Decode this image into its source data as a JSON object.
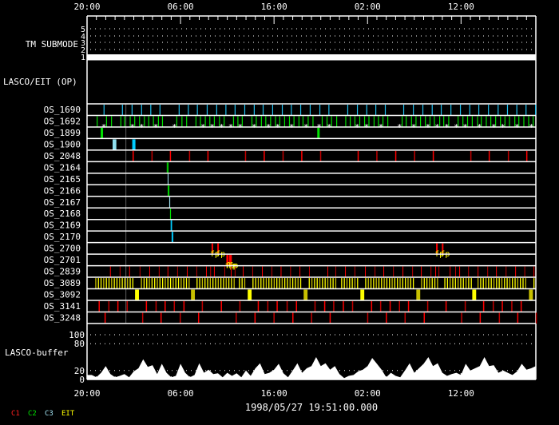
{
  "chart_data": {
    "type": "timeline",
    "start_label": "1998/05/27 19:51:00.000",
    "time_ticks": [
      "20:00",
      "06:00",
      "16:00",
      "02:00",
      "12:00"
    ],
    "time_range": [
      "20:00",
      "20:00"
    ],
    "background": "#000000",
    "foreground": "#ffffff",
    "shading": {
      "from": "00:06",
      "to": "00:12",
      "color": "#505050"
    },
    "tm_submode": {
      "label": "TM SUBMODE",
      "levels": [
        "1",
        "2",
        "3",
        "4",
        "5"
      ],
      "value": 1
    },
    "op_panel": {
      "label": "LASCO/EIT (OP)"
    },
    "rows": [
      {
        "name": "OS_1690",
        "color": "#20c0f0",
        "width": 1.2,
        "events": [
          "21:49",
          "23:47",
          "00:49",
          "01:50",
          "02:49",
          "03:48",
          "05:51",
          "06:50",
          "07:48",
          "08:51",
          "09:52",
          "10:51",
          "11:50",
          "12:52",
          "13:53",
          "14:50",
          "15:51",
          "16:53",
          "17:51",
          "18:51",
          "19:52",
          "20:54",
          "21:52",
          "23:53",
          "00:55",
          "01:55",
          "02:53",
          "03:54",
          "05:52",
          "06:54",
          "07:55",
          "08:55",
          "09:53",
          "10:55",
          "11:56",
          "12:56",
          "13:54",
          "14:56",
          "15:58",
          "16:58",
          "17:58",
          "18:57",
          "19:58"
        ]
      },
      {
        "name": "OS_1692",
        "color": "#00e000",
        "width": 1.2,
        "events": [
          "21:05",
          "22:05",
          "22:37",
          "23:37",
          "00:01",
          "00:37",
          "01:06",
          "01:37",
          "02:08",
          "02:36",
          "03:06",
          "03:38",
          "04:04",
          "05:36",
          "06:09",
          "06:39",
          "07:39",
          "08:08",
          "08:39",
          "09:08",
          "09:37",
          "10:10",
          "10:40",
          "11:40",
          "12:08",
          "12:36",
          "13:38",
          "14:06",
          "14:39",
          "15:07",
          "15:38",
          "16:09",
          "16:37",
          "17:08",
          "17:39",
          "18:08",
          "18:40",
          "19:06",
          "19:39",
          "20:10",
          "21:09",
          "21:40",
          "22:09",
          "22:42",
          "23:40",
          "00:09",
          "00:39",
          "01:10",
          "01:41",
          "02:09",
          "02:42",
          "03:10",
          "03:39",
          "04:10",
          "05:42",
          "06:08",
          "06:42",
          "07:11",
          "07:40",
          "08:11",
          "08:41",
          "09:09",
          "09:43",
          "10:09",
          "10:41",
          "11:41",
          "12:12",
          "12:42",
          "13:12",
          "13:46",
          "14:10",
          "14:42",
          "15:11",
          "15:42",
          "16:13",
          "16:42",
          "17:11",
          "17:45",
          "18:11",
          "18:43",
          "19:14",
          "19:43"
        ],
        "markers": {
          "symbol": "*",
          "color": "#ffffff",
          "events": [
            "21:48",
            "00:51",
            "01:50",
            "03:21",
            "05:20",
            "08:24",
            "09:23",
            "10:23",
            "11:23",
            "12:23",
            "13:52",
            "15:24",
            "16:24",
            "17:53",
            "19:25",
            "20:49",
            "21:54",
            "00:53",
            "01:53",
            "03:26",
            "05:25",
            "06:56",
            "08:28",
            "09:26",
            "10:28",
            "11:29",
            "12:27",
            "13:58",
            "15:30",
            "16:28",
            "17:59",
            "19:31"
          ]
        }
      },
      {
        "name": "OS_1899",
        "color": "#00e000",
        "width": 3,
        "events": [
          "21:35",
          "20:45"
        ]
      },
      {
        "name": "OS_1900",
        "colors": [
          "#90e0f0",
          "#00ccff"
        ],
        "blocks": [
          [
            "22:44",
            "23:08"
          ],
          [
            "00:50",
            "01:09"
          ]
        ]
      },
      {
        "name": "OS_2048",
        "colors": [
          "#ff0000",
          "#c00000"
        ],
        "width": 1.5,
        "events": [
          "00:56",
          "02:57",
          "04:55",
          "06:58",
          "08:56",
          "12:57",
          "14:57",
          "16:58",
          "18:58",
          "20:59",
          "01:00",
          "03:00",
          "05:01",
          "07:02",
          "09:02",
          "13:03",
          "15:01",
          "17:04",
          "19:02"
        ]
      },
      {
        "name": "OS_2164",
        "color": "#00e000",
        "width": 1,
        "events": [
          "04:34",
          "04:40"
        ]
      },
      {
        "name": "OS_2165",
        "color": "#a0e0f0",
        "width": 1,
        "events": [
          "04:40",
          "04:40"
        ]
      },
      {
        "name": "OS_2166",
        "color": "#00e000",
        "width": 1,
        "events": [
          "04:40",
          "04:46"
        ]
      },
      {
        "name": "OS_2167",
        "color": "#a0e0f0",
        "width": 1,
        "events": [
          "04:50",
          "04:51"
        ]
      },
      {
        "name": "OS_2168",
        "color": "#00e000",
        "width": 1,
        "events": [
          "04:55",
          "04:56"
        ]
      },
      {
        "name": "OS_2169",
        "color": "#00ccff",
        "width": 1,
        "events": [
          "04:59",
          "05:03"
        ]
      },
      {
        "name": "OS_2170",
        "color": "#00ccff",
        "width": 1,
        "events": [
          "05:05",
          "05:11"
        ]
      },
      {
        "name": "OS_2700",
        "color": "#ff0000",
        "width": 2,
        "events": [
          "09:24",
          "10:01",
          "09:25",
          "10:02"
        ],
        "label": {
          "text": "fp",
          "color": "#ffff00"
        }
      },
      {
        "name": "OS_2701",
        "color": "#ff0000",
        "width": 2,
        "events": [
          "10:59",
          "11:16",
          "11:02",
          "11:24"
        ],
        "label": {
          "text": "fp",
          "color": "#ffff00"
        }
      },
      {
        "name": "OS_2839",
        "colors": [
          "#ff0000",
          "#c00000"
        ],
        "width": 1,
        "events": [
          "22:30",
          "23:32",
          "00:33",
          "01:40",
          "02:42",
          "03:43",
          "04:39",
          "05:41",
          "06:43",
          "07:44",
          "08:46",
          "09:13",
          "09:37",
          "10:44",
          "11:25",
          "11:50",
          "12:42",
          "13:43",
          "14:45",
          "15:46",
          "16:45",
          "17:46",
          "18:46",
          "19:47",
          "21:45",
          "22:36",
          "23:38",
          "00:39",
          "01:46",
          "02:48",
          "03:44",
          "04:46",
          "05:47",
          "06:49",
          "07:45",
          "08:47",
          "09:17",
          "09:38",
          "10:50",
          "11:25",
          "11:51",
          "12:48",
          "13:49",
          "14:51",
          "15:47",
          "16:49",
          "17:50",
          "18:49",
          "19:48"
        ]
      },
      {
        "name": "OS_3089",
        "colors": [
          "#ffff00",
          "#c8c000"
        ],
        "width": 1.3,
        "ranges": [
          [
            "20:56",
            "01:01"
          ],
          [
            "01:49",
            "07:05"
          ],
          [
            "07:46",
            "11:50"
          ],
          [
            "12:18",
            "13:00"
          ],
          [
            "13:45",
            "19:06"
          ],
          [
            "19:46",
            "22:49"
          ],
          [
            "23:14",
            "01:07"
          ],
          [
            "01:48",
            "07:04"
          ],
          [
            "07:47",
            "09:30"
          ],
          [
            "10:16",
            "13:08"
          ],
          [
            "13:49",
            "19:07"
          ],
          [
            "19:48",
            "19:48"
          ]
        ],
        "range_step_min": 17
      },
      {
        "name": "OS_3092",
        "colors": [
          "#ffff00",
          "#c8c000"
        ],
        "blocks": [
          [
            "01:08",
            "01:33"
          ],
          [
            "07:07",
            "07:32"
          ],
          [
            "13:11",
            "13:36"
          ],
          [
            "19:10",
            "19:35"
          ],
          [
            "01:14",
            "01:39"
          ],
          [
            "07:13",
            "07:38"
          ],
          [
            "13:12",
            "13:37"
          ],
          [
            "19:16",
            "19:41"
          ]
        ]
      },
      {
        "name": "OS_3141",
        "colors": [
          "#ff0000",
          "#c00000"
        ],
        "width": 1.5,
        "events": [
          "21:18",
          "22:20",
          "23:18",
          "00:18",
          "02:21",
          "03:23",
          "04:21",
          "05:20",
          "06:22",
          "08:20",
          "10:22",
          "12:21",
          "14:19",
          "15:20",
          "16:20",
          "17:24",
          "18:24",
          "20:23",
          "21:25",
          "22:23",
          "23:25",
          "00:24",
          "02:26",
          "03:24",
          "04:25",
          "05:25",
          "06:23",
          "08:26",
          "10:24",
          "12:27",
          "14:25",
          "15:27",
          "16:25",
          "17:26",
          "18:26"
        ]
      },
      {
        "name": "OS_3248",
        "colors": [
          "#ff0000",
          "#c00000"
        ],
        "width": 1.5,
        "events": [
          "21:56",
          "01:57",
          "03:55",
          "05:58",
          "07:56",
          "11:57",
          "13:58",
          "16:00",
          "18:01",
          "20:01",
          "22:00",
          "02:01",
          "04:01",
          "06:01",
          "08:04",
          "12:04",
          "14:03",
          "16:06",
          "18:04",
          "20:03"
        ]
      }
    ],
    "buffer": {
      "label": "LASCO-buffer",
      "ylim": [
        0,
        100
      ],
      "yticks": [
        "0",
        "20",
        "80",
        "100"
      ],
      "gridlines": [
        20,
        80,
        100
      ],
      "points": [
        [
          "20:00",
          10
        ],
        [
          "20:30",
          10
        ],
        [
          "21:00",
          5
        ],
        [
          "21:30",
          15
        ],
        [
          "22:00",
          30
        ],
        [
          "22:30",
          12
        ],
        [
          "23:00",
          5
        ],
        [
          "23:30",
          8
        ],
        [
          "00:00",
          12
        ],
        [
          "00:30",
          5
        ],
        [
          "01:00",
          18
        ],
        [
          "01:30",
          25
        ],
        [
          "02:00",
          45
        ],
        [
          "02:30",
          28
        ],
        [
          "03:00",
          32
        ],
        [
          "03:30",
          12
        ],
        [
          "04:00",
          35
        ],
        [
          "04:30",
          15
        ],
        [
          "05:00",
          5
        ],
        [
          "05:30",
          8
        ],
        [
          "06:00",
          35
        ],
        [
          "06:30",
          15
        ],
        [
          "07:00",
          5
        ],
        [
          "07:30",
          10
        ],
        [
          "08:00",
          36
        ],
        [
          "08:30",
          15
        ],
        [
          "09:00",
          22
        ],
        [
          "09:30",
          12
        ],
        [
          "10:00",
          14
        ],
        [
          "10:30",
          5
        ],
        [
          "11:00",
          15
        ],
        [
          "11:30",
          8
        ],
        [
          "12:00",
          14
        ],
        [
          "12:30",
          5
        ],
        [
          "13:00",
          20
        ],
        [
          "13:30",
          8
        ],
        [
          "14:00",
          25
        ],
        [
          "14:30",
          36
        ],
        [
          "15:00",
          12
        ],
        [
          "15:30",
          15
        ],
        [
          "16:00",
          22
        ],
        [
          "16:30",
          35
        ],
        [
          "17:00",
          14
        ],
        [
          "17:30",
          5
        ],
        [
          "18:00",
          20
        ],
        [
          "18:30",
          36
        ],
        [
          "19:00",
          15
        ],
        [
          "19:30",
          25
        ],
        [
          "20:00",
          30
        ],
        [
          "20:30",
          50
        ],
        [
          "21:00",
          30
        ],
        [
          "21:30",
          36
        ],
        [
          "22:00",
          22
        ],
        [
          "22:30",
          30
        ],
        [
          "23:00",
          12
        ],
        [
          "23:30",
          3
        ],
        [
          "00:00",
          8
        ],
        [
          "00:30",
          10
        ],
        [
          "01:00",
          18
        ],
        [
          "01:30",
          22
        ],
        [
          "02:00",
          30
        ],
        [
          "02:30",
          48
        ],
        [
          "03:00",
          35
        ],
        [
          "03:30",
          22
        ],
        [
          "04:00",
          5
        ],
        [
          "04:30",
          15
        ],
        [
          "05:00",
          8
        ],
        [
          "05:30",
          5
        ],
        [
          "06:00",
          20
        ],
        [
          "06:30",
          36
        ],
        [
          "07:00",
          15
        ],
        [
          "07:30",
          25
        ],
        [
          "08:00",
          35
        ],
        [
          "08:30",
          50
        ],
        [
          "09:00",
          30
        ],
        [
          "09:30",
          36
        ],
        [
          "10:00",
          15
        ],
        [
          "10:30",
          8
        ],
        [
          "11:00",
          12
        ],
        [
          "11:30",
          15
        ],
        [
          "12:00",
          10
        ],
        [
          "12:30",
          35
        ],
        [
          "13:00",
          20
        ],
        [
          "13:30",
          25
        ],
        [
          "14:00",
          30
        ],
        [
          "14:30",
          50
        ],
        [
          "15:00",
          30
        ],
        [
          "15:30",
          32
        ],
        [
          "16:00",
          15
        ],
        [
          "16:30",
          20
        ],
        [
          "17:00",
          15
        ],
        [
          "17:30",
          10
        ],
        [
          "18:00",
          18
        ],
        [
          "18:30",
          35
        ],
        [
          "19:00",
          22
        ],
        [
          "19:30",
          25
        ],
        [
          "20:00",
          30
        ]
      ]
    },
    "legend": [
      {
        "label": "C1",
        "color": "#ff2020"
      },
      {
        "label": "C2",
        "color": "#00e000"
      },
      {
        "label": "C3",
        "color": "#a0e0f0"
      },
      {
        "label": "EIT",
        "color": "#ffff00"
      }
    ]
  }
}
